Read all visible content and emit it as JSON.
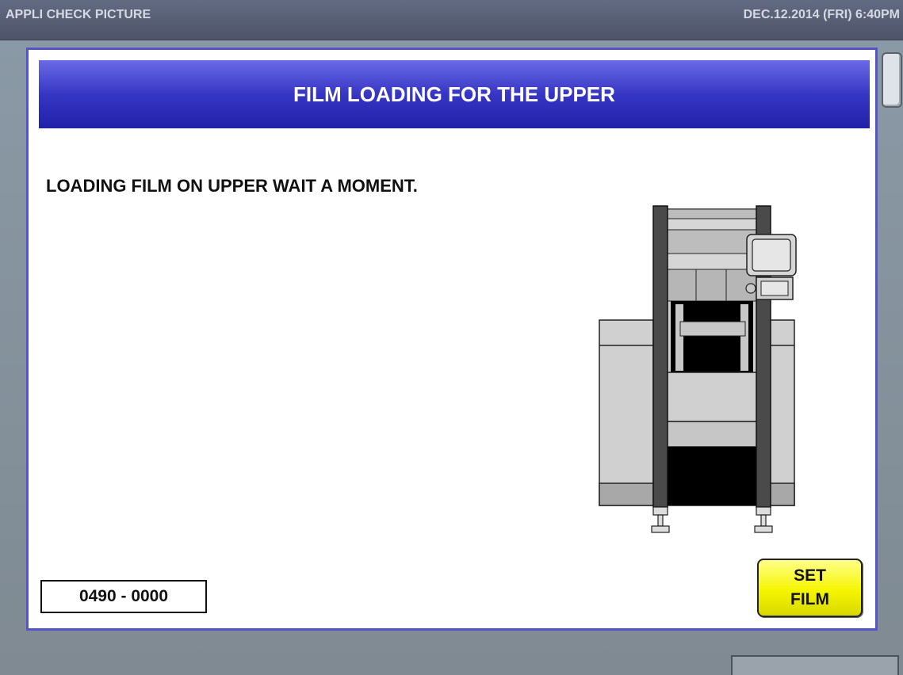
{
  "topbar": {
    "title": "APPLI CHECK PICTURE",
    "datetime": "DEC.12.2014 (FRI)   6:40PM"
  },
  "dialog": {
    "header": "FILM LOADING FOR THE UPPER",
    "message": "LOADING FILM ON UPPER WAIT A MOMENT.",
    "code": "0490 - 0000",
    "set_film_line1": "SET",
    "set_film_line2": "FILM"
  },
  "colors": {
    "header_blue": "#3636c4",
    "button_yellow": "#f5f500",
    "frame_border": "#5555c8"
  },
  "icons": {
    "machine": "packaging-machine-illustration"
  }
}
